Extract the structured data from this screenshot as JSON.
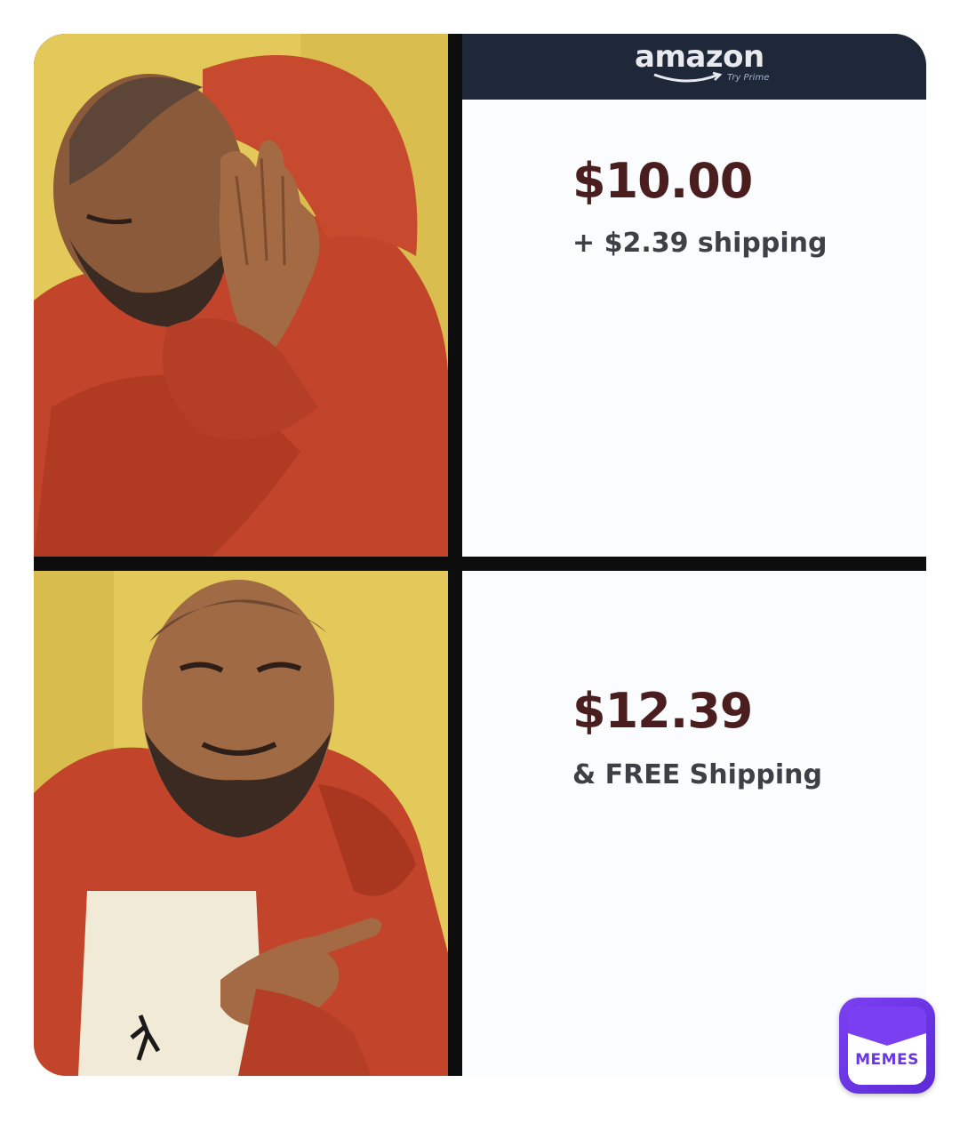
{
  "panels": [
    {
      "reaction": "reject",
      "price": "$10.00",
      "shipping": "+ $2.39 shipping"
    },
    {
      "reaction": "approve",
      "price": "$12.39",
      "shipping": "& FREE Shipping"
    }
  ],
  "brand": {
    "name": "amazon",
    "tagline": "Try Prime"
  },
  "watermark": {
    "label": "MEMES"
  },
  "colors": {
    "photo_background": "#e3c95a",
    "jacket": "#c2442a",
    "price_text": "#4a1e1f",
    "amazon_bar": "#1f2839",
    "badge": "#6a36e8"
  },
  "icons": {
    "top_photo": "man-rejecting-gesture-photo",
    "bottom_photo": "man-approving-gesture-photo",
    "watermark": "memes-app-icon"
  }
}
